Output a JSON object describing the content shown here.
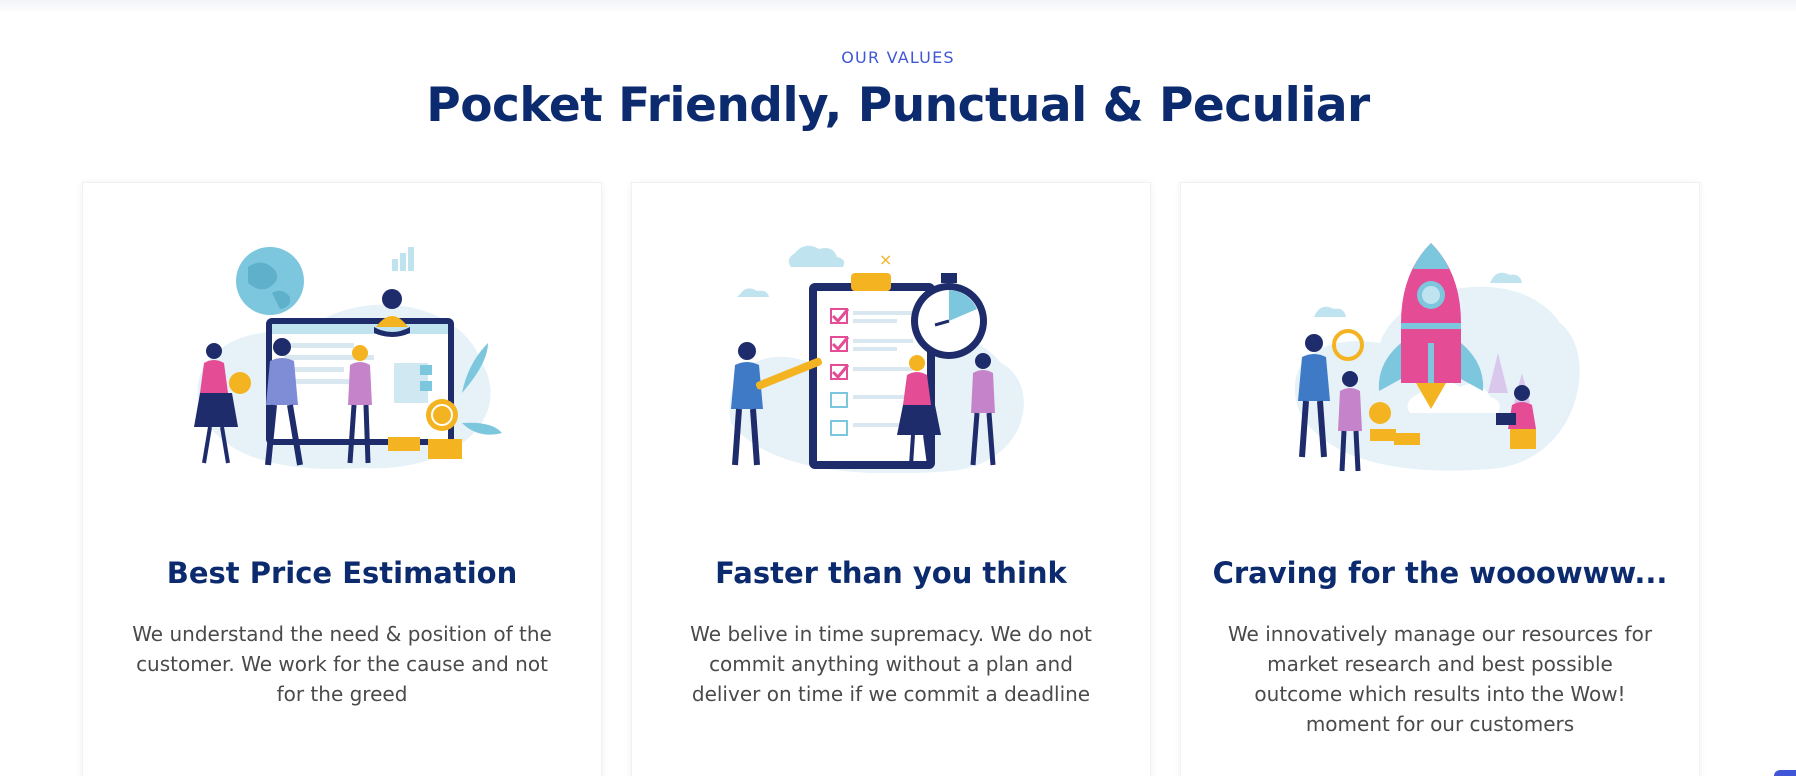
{
  "section": {
    "eyebrow": "OUR VALUES",
    "title": "Pocket Friendly, Punctual & Peculiar"
  },
  "cards": [
    {
      "title": "Best Price Estimation",
      "text": "We understand the need & position of the customer. We work for the cause and not for the greed",
      "illustration": "team-pricing-illustration"
    },
    {
      "title": "Faster than you think",
      "text": "We belive in time supremacy. We do not commit anything without a plan and deliver on time if we commit a deadline",
      "illustration": "checklist-stopwatch-illustration"
    },
    {
      "title": "Craving for the wooowww...",
      "text": "We innovatively manage our resources for market research and best possible outcome which results into the Wow! moment for our customers",
      "illustration": "rocket-launch-illustration"
    }
  ],
  "colors": {
    "accent": "#3f56d6",
    "heading": "#0c2a6e",
    "body_text": "#4a4a4a",
    "illustration_blue": "#7cc7de",
    "illustration_pink": "#e44d96",
    "illustration_navy": "#1f2c6b",
    "illustration_gold": "#f4b321"
  }
}
